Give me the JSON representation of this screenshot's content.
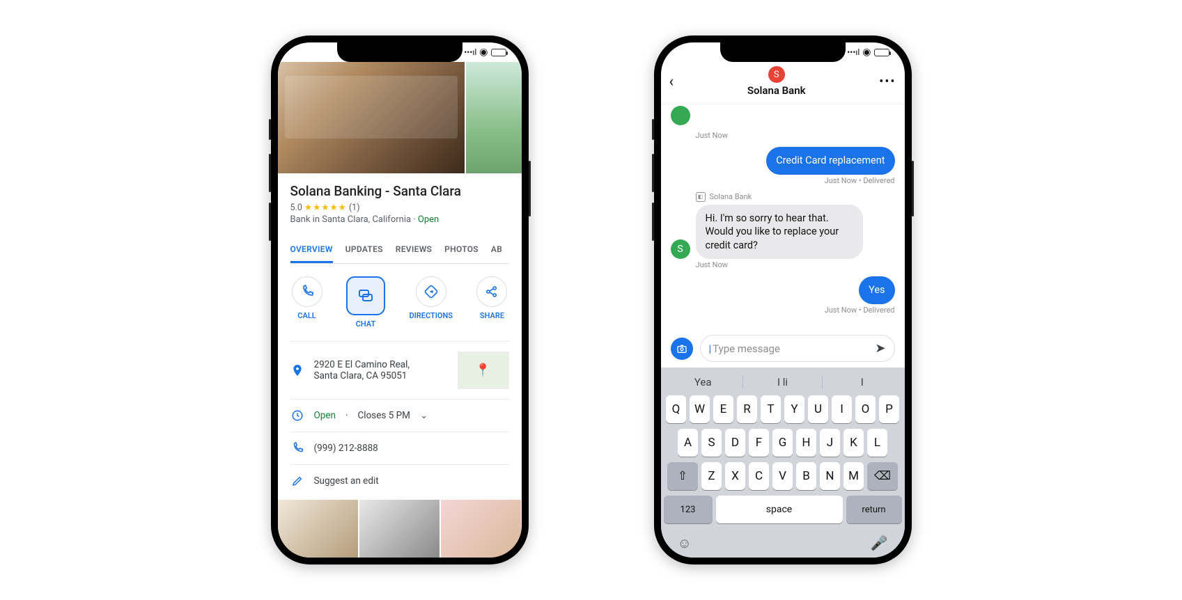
{
  "phone1": {
    "business_title": "Solana Banking - Santa Clara",
    "rating_value": "5.0",
    "rating_count": "(1)",
    "category_text": "Bank in Santa Clara, California",
    "status_open": "Open",
    "tabs": {
      "overview": "OVERVIEW",
      "updates": "UPDATES",
      "reviews": "REVIEWS",
      "photos": "PHOTOS",
      "about_partial": "AB"
    },
    "actions": {
      "call": "CALL",
      "chat": "CHAT",
      "directions": "DIRECTIONS",
      "share": "SHARE"
    },
    "address": "2920 E El Camino Real, Santa Clara, CA 95051",
    "hours_status": "Open",
    "hours_detail": "Closes 5 PM",
    "phone_number": "(999) 212-8888",
    "suggest_edit": "Suggest an edit"
  },
  "phone2": {
    "header_name": "Solana Bank",
    "header_initial": "S",
    "thread": {
      "ts1": "Just Now",
      "msg_user1": "Credit Card replacement",
      "ts2": "Just Now • Delivered",
      "agent_label": "Solana  Bank",
      "msg_agent": "Hi. I'm so sorry to hear that. Would you like to replace your credit card?",
      "ts3": "Just Now",
      "msg_user2": "Yes",
      "ts4": "Just Now • Delivered"
    },
    "composer_placeholder": "Type message",
    "keyboard": {
      "suggestions": {
        "s1": "Yea",
        "s2": "I li",
        "s3": "I"
      },
      "row1": [
        "Q",
        "W",
        "E",
        "R",
        "T",
        "Y",
        "U",
        "I",
        "O",
        "P"
      ],
      "row2": [
        "A",
        "S",
        "D",
        "F",
        "G",
        "H",
        "J",
        "K",
        "L"
      ],
      "row3": [
        "Z",
        "X",
        "C",
        "V",
        "B",
        "N",
        "M"
      ],
      "num_key": "123",
      "space_key": "space",
      "return_key": "return"
    }
  }
}
